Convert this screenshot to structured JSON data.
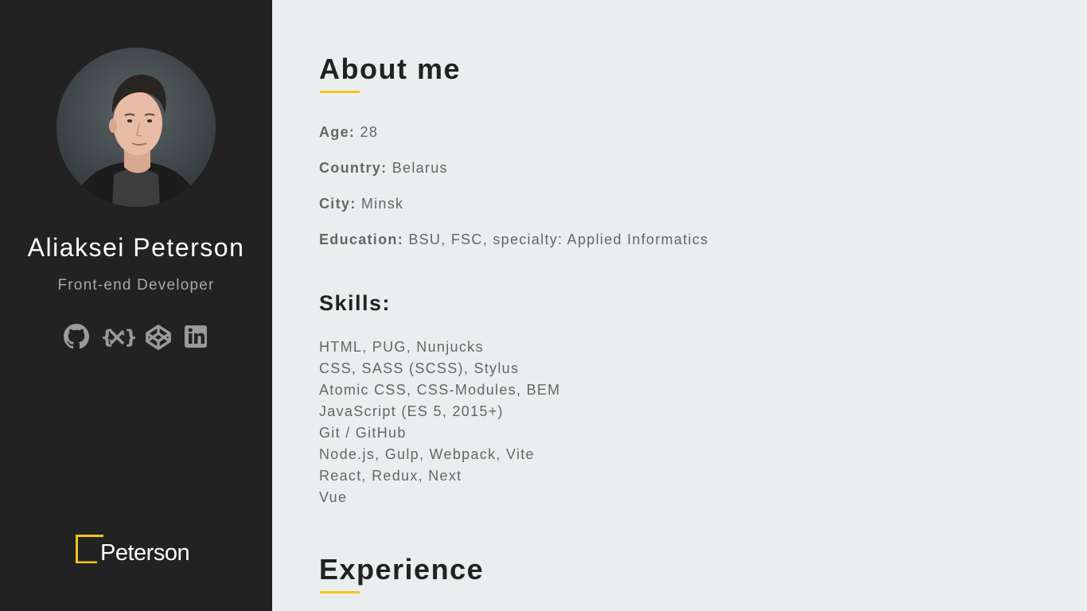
{
  "profile": {
    "name": "Aliaksei Peterson",
    "role": "Front-end Developer"
  },
  "socials": [
    {
      "icon": "github-icon",
      "label": "GitHub"
    },
    {
      "icon": "codewars-icon",
      "label": "Codewars"
    },
    {
      "icon": "codepen-icon",
      "label": "CodePen"
    },
    {
      "icon": "linkedin-icon",
      "label": "LinkedIn"
    }
  ],
  "logo": {
    "text": "Peterson"
  },
  "about": {
    "title": "About me",
    "items": [
      {
        "label": "Age:",
        "value": "28"
      },
      {
        "label": "Country:",
        "value": "Belarus"
      },
      {
        "label": "City:",
        "value": "Minsk"
      },
      {
        "label": "Education:",
        "value": "BSU, FSC, specialty: Applied Informatics"
      }
    ]
  },
  "skills": {
    "title": "Skills:",
    "items": [
      "HTML, PUG, Nunjucks",
      "CSS, SASS (SCSS), Stylus",
      "Atomic CSS, CSS-Modules, BEM",
      "JavaScript (ES 5, 2015+)",
      "Git / GitHub",
      "Node.js, Gulp, Webpack, Vite",
      "React, Redux, Next",
      "Vue"
    ]
  },
  "experience": {
    "title": "Experience"
  },
  "colors": {
    "sidebar": "#222222",
    "background": "#ebeeef",
    "accent": "#f5c518",
    "text_muted": "#666666"
  }
}
